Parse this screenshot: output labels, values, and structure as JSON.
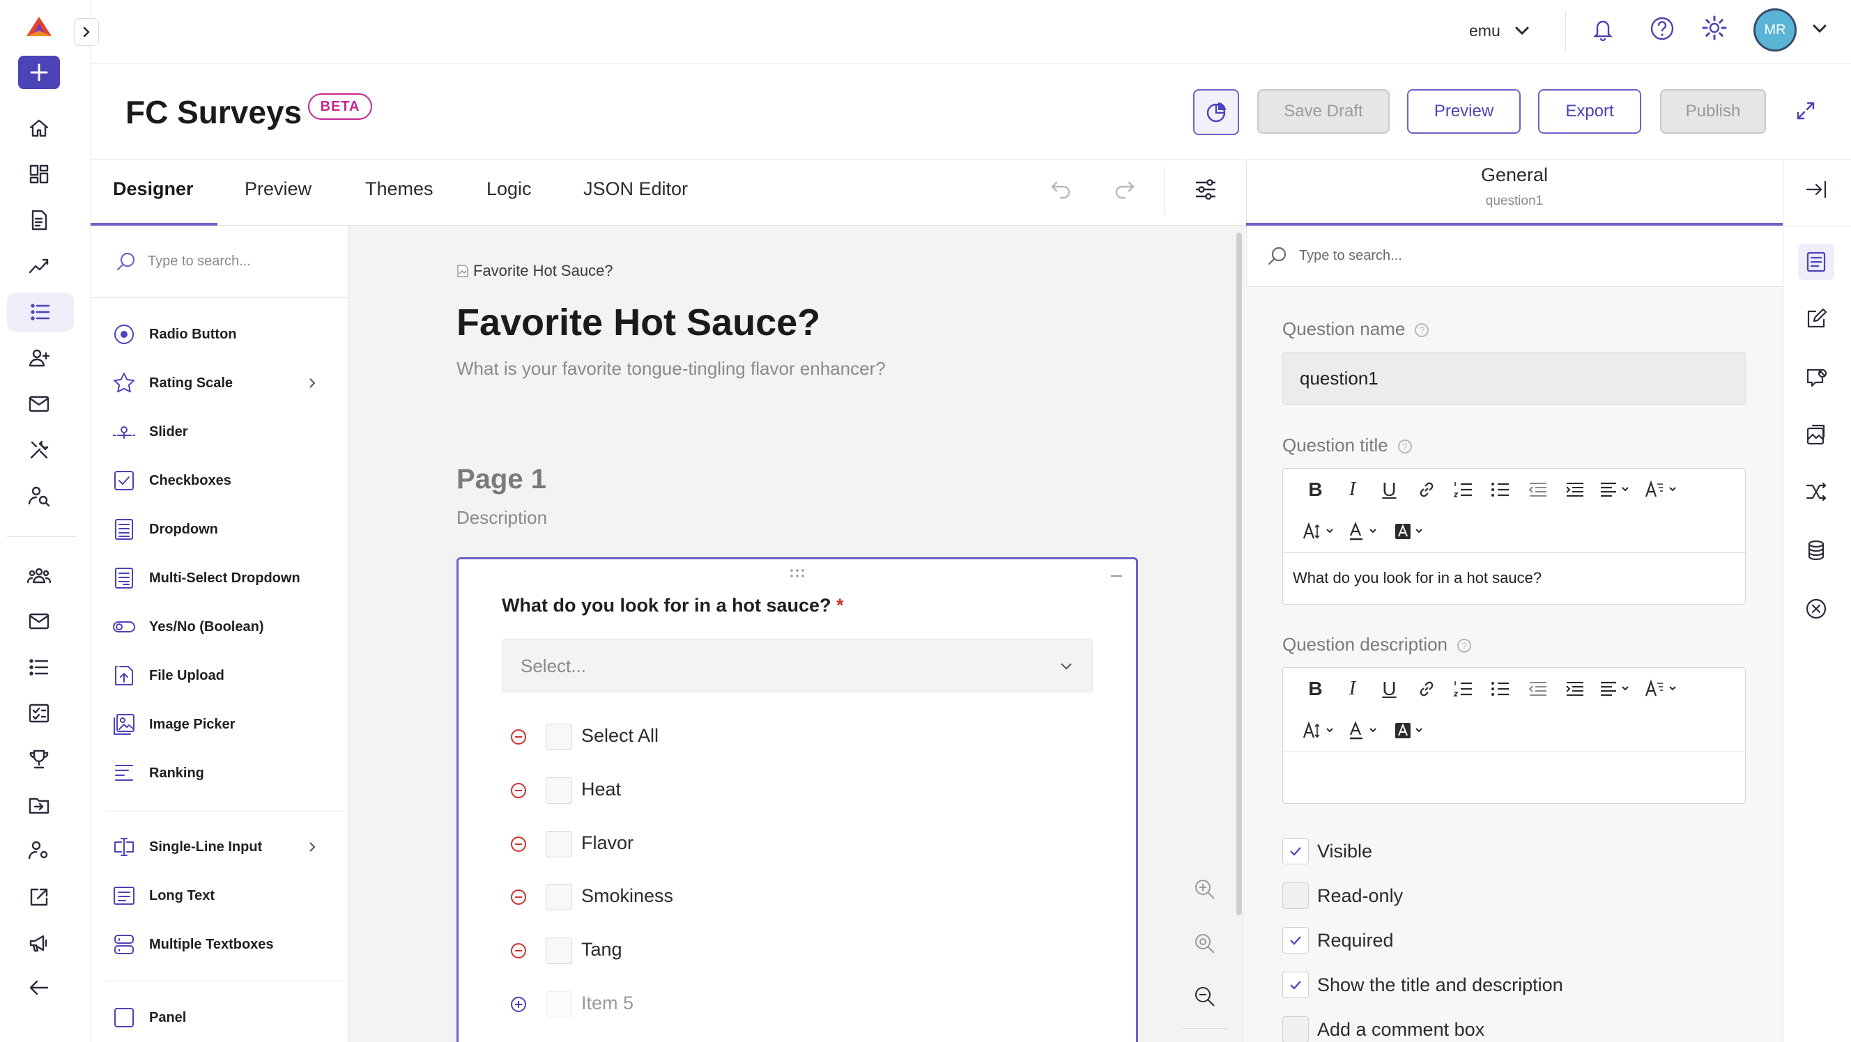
{
  "app": {
    "logo": "brand-logo-icon",
    "new_button": "+"
  },
  "topbar": {
    "workspace": "emu",
    "avatar_initials": "MR"
  },
  "header": {
    "title": "FC Surveys",
    "badge": "BETA",
    "buttons": {
      "save_draft": "Save Draft",
      "preview": "Preview",
      "export": "Export",
      "publish": "Publish"
    }
  },
  "tabs": [
    {
      "label": "Designer",
      "active": true
    },
    {
      "label": "Preview"
    },
    {
      "label": "Themes"
    },
    {
      "label": "Logic"
    },
    {
      "label": "JSON Editor"
    }
  ],
  "toolbox": {
    "search_placeholder": "Type to search...",
    "items": [
      {
        "label": "Radio Button",
        "icon": "radio-icon"
      },
      {
        "label": "Rating Scale",
        "icon": "star-icon",
        "has_submenu": true
      },
      {
        "label": "Slider",
        "icon": "slider-icon"
      },
      {
        "label": "Checkboxes",
        "icon": "checkbox-icon"
      },
      {
        "label": "Dropdown",
        "icon": "dropdown-icon"
      },
      {
        "label": "Multi-Select Dropdown",
        "icon": "multi-dropdown-icon"
      },
      {
        "label": "Yes/No (Boolean)",
        "icon": "toggle-icon"
      },
      {
        "label": "File Upload",
        "icon": "file-upload-icon"
      },
      {
        "label": "Image Picker",
        "icon": "image-picker-icon"
      },
      {
        "label": "Ranking",
        "icon": "ranking-icon"
      },
      {
        "label": "Single-Line Input",
        "icon": "text-input-icon",
        "has_submenu": true
      },
      {
        "label": "Long Text",
        "icon": "long-text-icon"
      },
      {
        "label": "Multiple Textboxes",
        "icon": "multiple-textboxes-icon"
      },
      {
        "label": "Panel",
        "icon": "panel-icon"
      }
    ]
  },
  "survey": {
    "logo_alt": "Favorite Hot Sauce?",
    "title": "Favorite Hot Sauce?",
    "description": "What is your favorite tongue-tingling flavor enhancer?",
    "page_title": "Page 1",
    "page_description": "Description",
    "question": {
      "title": "What do you look for in a hot sauce?",
      "required_mark": "*",
      "select_placeholder": "Select...",
      "options": [
        "Select All",
        "Heat",
        "Flavor",
        "Smokiness",
        "Tang"
      ],
      "new_option": "Item 5"
    }
  },
  "properties": {
    "section_title": "General",
    "section_subtitle": "question1",
    "search_placeholder": "Type to search...",
    "question_name_label": "Question name",
    "question_name_value": "question1",
    "question_title_label": "Question title",
    "question_title_value": "What do you look for in a hot sauce?",
    "question_description_label": "Question description",
    "question_description_value": "",
    "checkboxes": [
      {
        "label": "Visible",
        "checked": true
      },
      {
        "label": "Read-only",
        "checked": false
      },
      {
        "label": "Required",
        "checked": true
      },
      {
        "label": "Show the title and description",
        "checked": true
      },
      {
        "label": "Add a comment box",
        "checked": false
      }
    ]
  },
  "colors": {
    "accent": "#4b43b7",
    "accent_light": "#6b63c9",
    "required": "#d0312d",
    "badge": "#c3268f",
    "avatar": "#5ab4d6"
  }
}
